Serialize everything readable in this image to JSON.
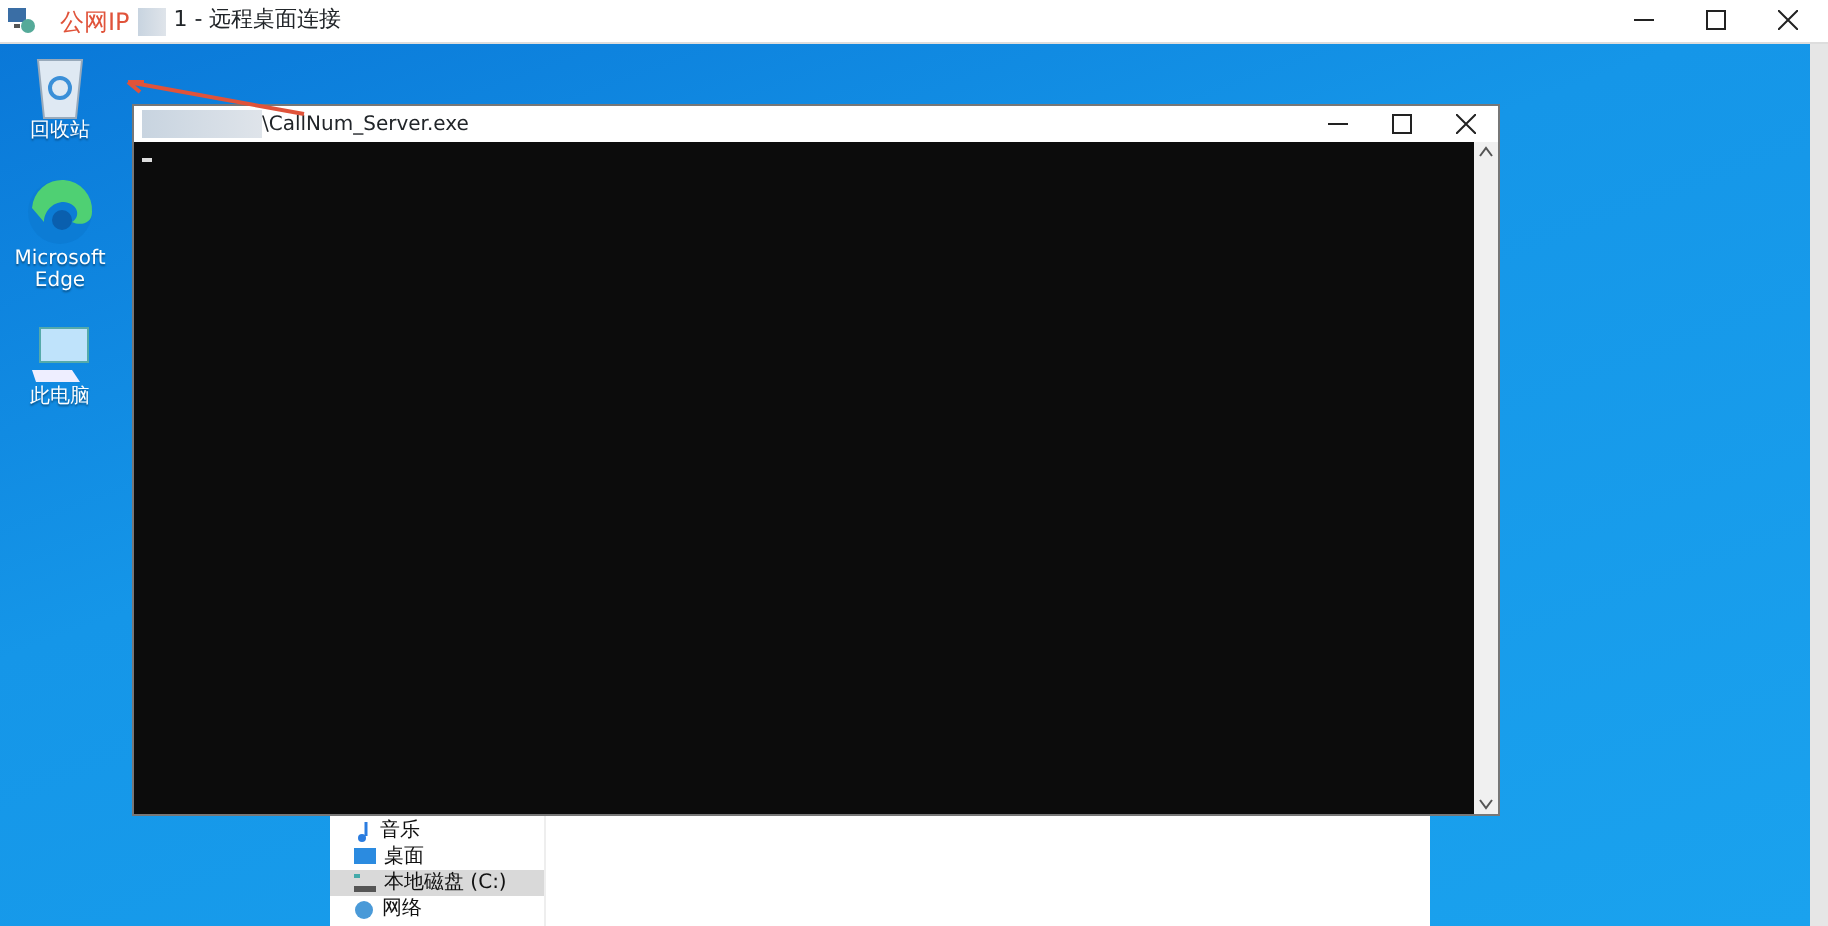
{
  "remote_window": {
    "title_annotation": "公网IP",
    "title": "1 - 远程桌面连接"
  },
  "desktop_icons": [
    {
      "kind": "recycle",
      "label": "回收站"
    },
    {
      "kind": "edge",
      "label": "Microsoft Edge"
    },
    {
      "kind": "computer",
      "label": "此电脑"
    }
  ],
  "console": {
    "title": "\\CallNum_Server.exe"
  },
  "explorer": {
    "nav_items": [
      {
        "kind": "music",
        "label": "音乐",
        "selected": false
      },
      {
        "kind": "desktop",
        "label": "桌面",
        "selected": false
      },
      {
        "kind": "drive",
        "label": "本地磁盘 (C:)",
        "selected": true
      },
      {
        "kind": "network",
        "label": "网络",
        "selected": false
      }
    ]
  }
}
